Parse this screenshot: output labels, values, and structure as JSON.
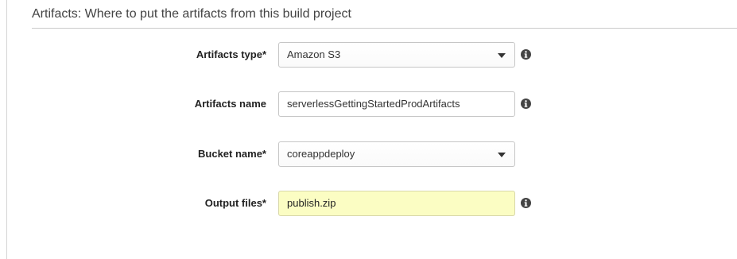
{
  "section": {
    "title": "Artifacts: Where to put the artifacts from this build project"
  },
  "fields": {
    "artifacts_type": {
      "label": "Artifacts type*",
      "value": "Amazon S3",
      "icon": "info-icon"
    },
    "artifacts_name": {
      "label": "Artifacts name",
      "value": "serverlessGettingStartedProdArtifacts",
      "icon": "info-icon"
    },
    "bucket_name": {
      "label": "Bucket name*",
      "value": "coreappdeploy"
    },
    "output_files": {
      "label": "Output files*",
      "value": "publish.zip",
      "icon": "info-icon",
      "highlight_color": "#fbfdc3"
    }
  }
}
